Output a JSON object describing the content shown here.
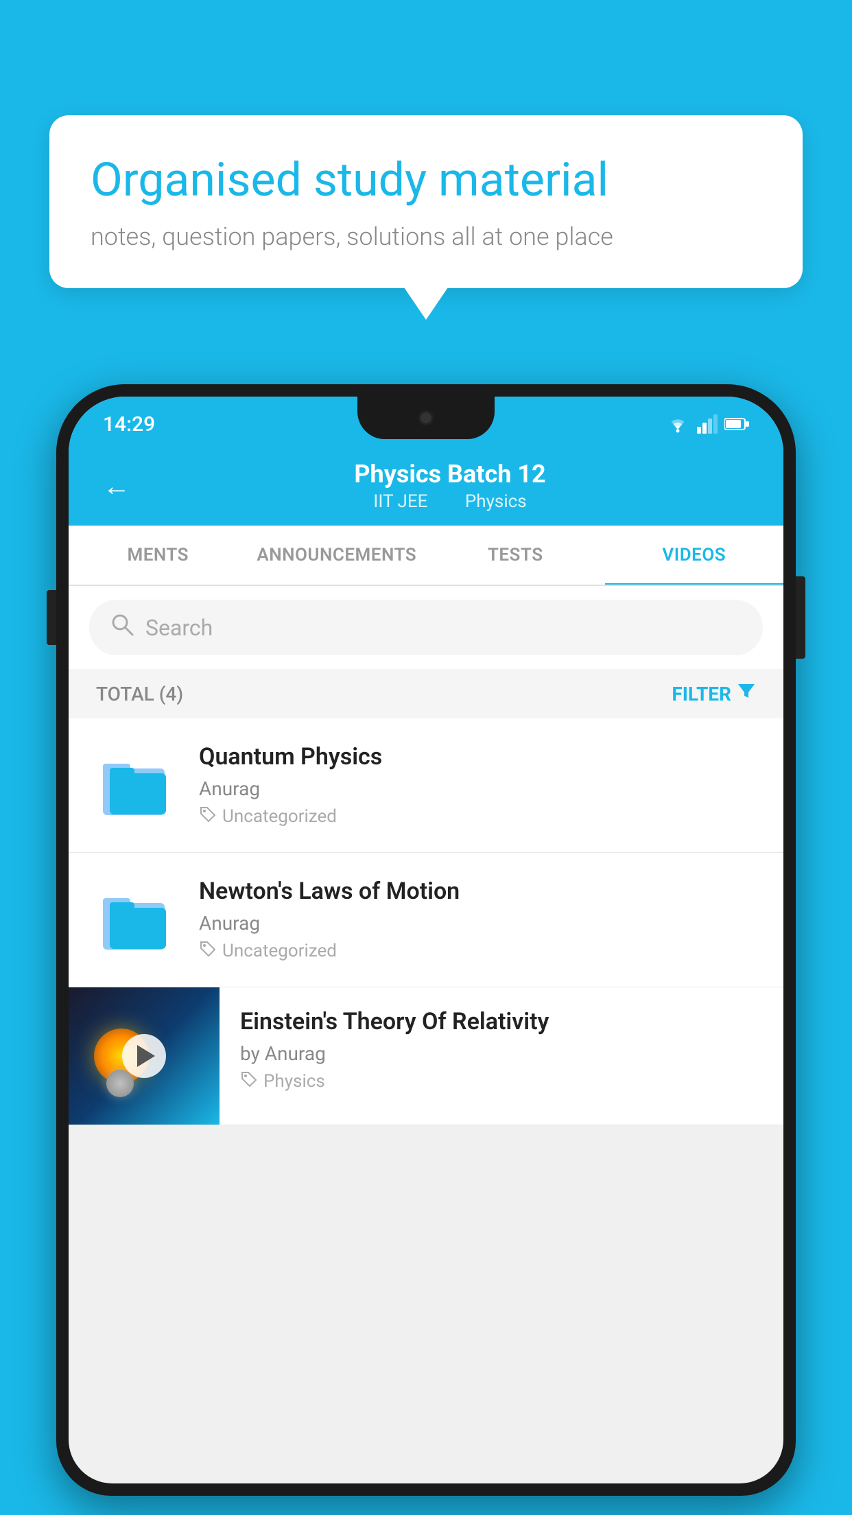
{
  "background_color": "#1ab8e8",
  "speech_bubble": {
    "title": "Organised study material",
    "subtitle": "notes, question papers, solutions all at one place"
  },
  "status_bar": {
    "time": "14:29",
    "wifi": "▼",
    "signal": "▲",
    "battery": "▮"
  },
  "app_header": {
    "back_label": "←",
    "title": "Physics Batch 12",
    "subtitle_part1": "IIT JEE",
    "subtitle_part2": "Physics"
  },
  "tabs": [
    {
      "label": "MENTS",
      "active": false
    },
    {
      "label": "ANNOUNCEMENTS",
      "active": false
    },
    {
      "label": "TESTS",
      "active": false
    },
    {
      "label": "VIDEOS",
      "active": true
    }
  ],
  "search": {
    "placeholder": "Search"
  },
  "filter_bar": {
    "total_label": "TOTAL (4)",
    "filter_label": "FILTER"
  },
  "videos": [
    {
      "type": "folder",
      "title": "Quantum Physics",
      "author": "Anurag",
      "category": "Uncategorized"
    },
    {
      "type": "folder",
      "title": "Newton's Laws of Motion",
      "author": "Anurag",
      "category": "Uncategorized"
    },
    {
      "type": "thumbnail",
      "title": "Einstein's Theory Of Relativity",
      "author": "by Anurag",
      "category": "Physics"
    }
  ]
}
